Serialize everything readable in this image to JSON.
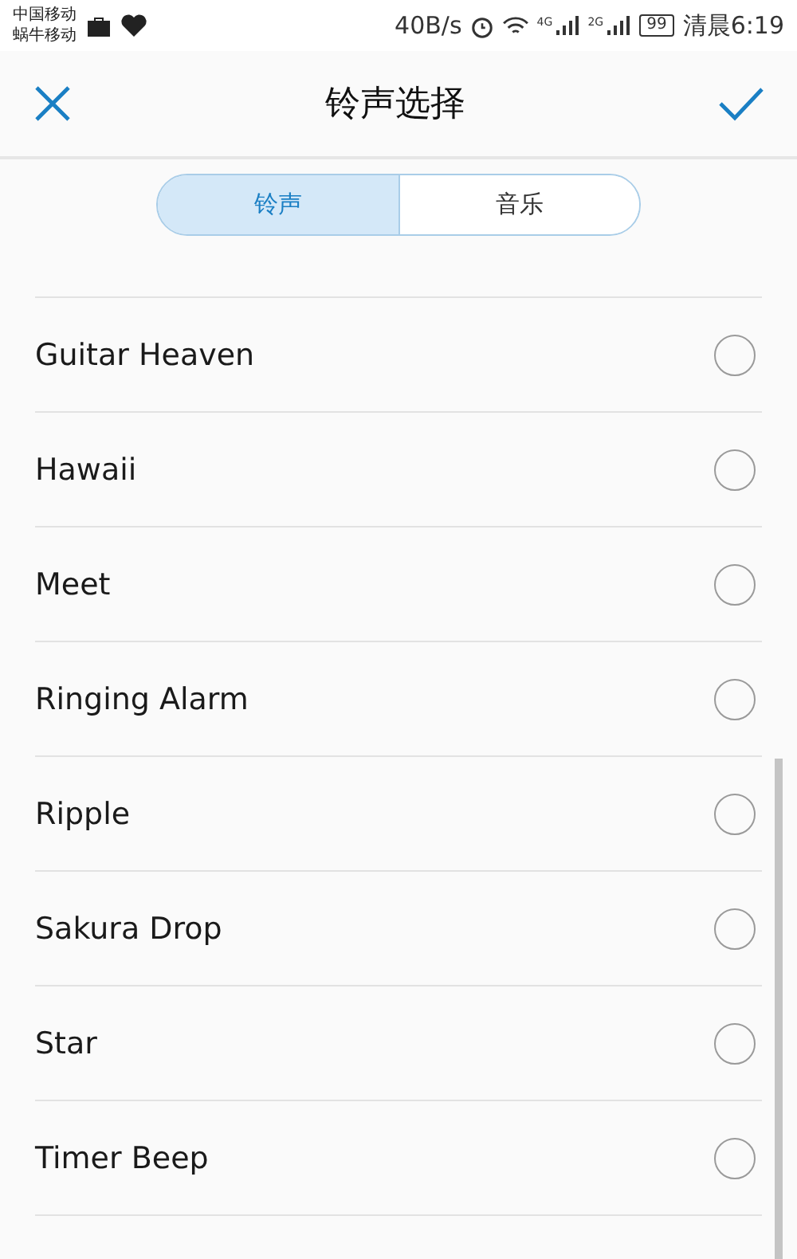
{
  "status_bar": {
    "carriers": [
      "中国移动",
      "蜗牛移动"
    ],
    "speed": "40B/s",
    "signal_labels": [
      "4G",
      "2G"
    ],
    "battery": "99",
    "time": "清晨6:19"
  },
  "header": {
    "title": "铃声选择"
  },
  "tabs": [
    {
      "label": "铃声",
      "selected": true
    },
    {
      "label": "音乐",
      "selected": false
    }
  ],
  "ringtones": [
    {
      "name": "Guitar Heaven",
      "selected": false
    },
    {
      "name": "Hawaii",
      "selected": false
    },
    {
      "name": "Meet",
      "selected": false
    },
    {
      "name": "Ringing Alarm",
      "selected": false
    },
    {
      "name": "Ripple",
      "selected": false
    },
    {
      "name": "Sakura Drop",
      "selected": false
    },
    {
      "name": "Star",
      "selected": false
    },
    {
      "name": "Timer Beep",
      "selected": false
    }
  ]
}
